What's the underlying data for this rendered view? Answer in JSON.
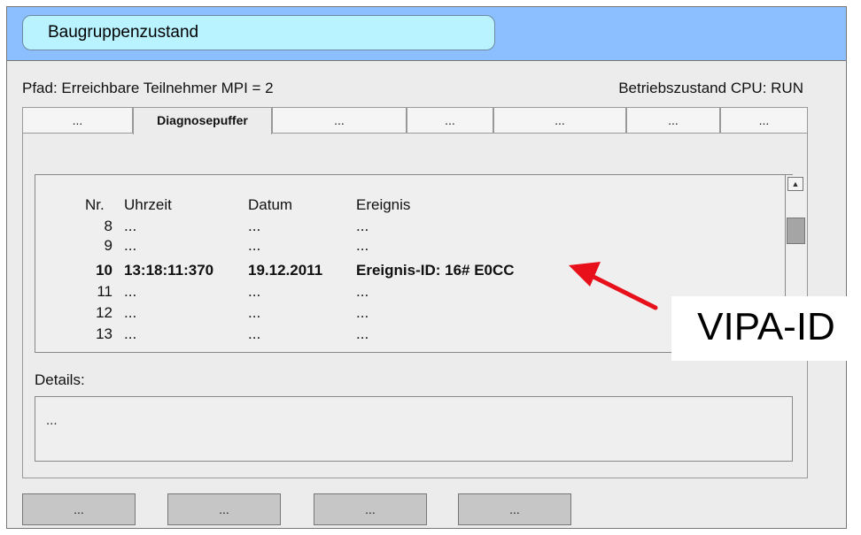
{
  "window": {
    "title": "Baugruppenzustand",
    "path_label": "Pfad: Erreichbare Teilnehmer MPI = 2",
    "mode_label": "Betriebszustand CPU: RUN"
  },
  "tabs": [
    {
      "label": "..."
    },
    {
      "label": "Diagnosepuffer",
      "active": true
    },
    {
      "label": "..."
    },
    {
      "label": "..."
    },
    {
      "label": "..."
    },
    {
      "label": "..."
    },
    {
      "label": "..."
    }
  ],
  "table": {
    "headers": {
      "nr": "Nr.",
      "time": "Uhrzeit",
      "date": "Datum",
      "event": "Ereignis"
    },
    "rows": [
      {
        "nr": "8",
        "time": "...",
        "date": "...",
        "event": "..."
      },
      {
        "nr": "9",
        "time": "...",
        "date": "...",
        "event": "..."
      },
      {
        "nr": "10",
        "time": "13:18:11:370",
        "date": "19.12.2011",
        "event": "Ereignis-ID: 16# E0CC",
        "highlighted": true
      },
      {
        "nr": "11",
        "time": "...",
        "date": "...",
        "event": "..."
      },
      {
        "nr": "12",
        "time": "...",
        "date": "...",
        "event": "..."
      },
      {
        "nr": "13",
        "time": "...",
        "date": "...",
        "event": "..."
      }
    ]
  },
  "details": {
    "label": "Details:",
    "value": "..."
  },
  "buttons": [
    {
      "label": "..."
    },
    {
      "label": "..."
    },
    {
      "label": "..."
    },
    {
      "label": "..."
    }
  ],
  "annotation": {
    "text": "VIPA-ID",
    "arrow_color": "#e8101a"
  },
  "colors": {
    "titlebar": "#8bbfff",
    "title_pill": "#b9f3ff",
    "window_bg": "#ececec",
    "button_bg": "#c6c6c6"
  },
  "icons": {
    "scroll_up": "triangle-up-icon"
  }
}
